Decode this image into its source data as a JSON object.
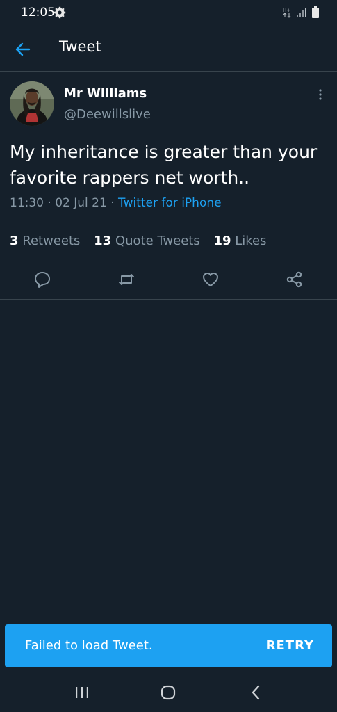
{
  "status_bar": {
    "time": "12:05",
    "settings_icon": "gear-icon",
    "network_icon": "data-arrows-icon",
    "signal_icon": "signal-bars-icon",
    "battery_icon": "battery-icon"
  },
  "app_bar": {
    "title": "Tweet",
    "back_icon": "back-arrow-icon"
  },
  "tweet": {
    "author_name": "Mr Williams",
    "author_handle": "@Deewillslive",
    "text": "My inheritance is greater than your favorite rappers net worth..",
    "time": "11:30",
    "date": "02 Jul 21",
    "separator": "·",
    "source": "Twitter for iPhone"
  },
  "stats": {
    "retweets_count": "3",
    "retweets_label": "Retweets",
    "quote_tweets_count": "13",
    "quote_tweets_label": "Quote Tweets",
    "likes_count": "19",
    "likes_label": "Likes"
  },
  "actions": [
    "reply-icon",
    "retweet-icon",
    "like-icon",
    "share-icon"
  ],
  "snackbar": {
    "message": "Failed to load Tweet.",
    "action": "RETRY"
  },
  "nav_bar": [
    "recent-apps-icon",
    "home-icon",
    "back-icon"
  ],
  "colors": {
    "background": "#15202b",
    "accent": "#1da1f2",
    "secondary_text": "#8899a6",
    "divider": "#38444d"
  }
}
